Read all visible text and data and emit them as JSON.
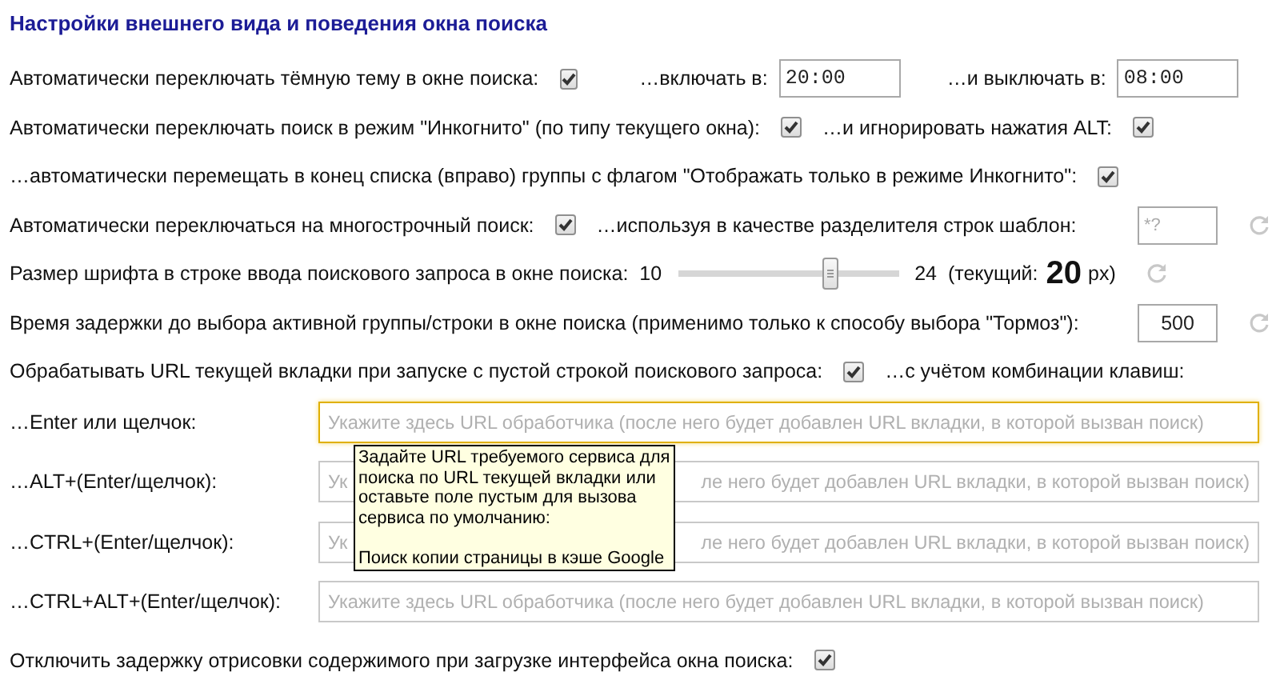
{
  "title": "Настройки внешнего вида и поведения окна поиска",
  "rows": [
    {
      "kind": "inline",
      "items": [
        {
          "kind": "text",
          "text": "Автоматически переключать тёмную тему в окне поиска:"
        },
        {
          "kind": "checkbox",
          "checked": true
        },
        {
          "kind": "text",
          "text": "…включать в:"
        },
        {
          "kind": "time",
          "value": "20:00"
        },
        {
          "kind": "text",
          "text": "…и выключать в:"
        },
        {
          "kind": "time",
          "value": "08:00"
        }
      ]
    },
    {
      "kind": "inline",
      "items": [
        {
          "kind": "text",
          "text": "Автоматически переключать поиск в режим \"Инкогнито\" (по типу текущего окна):"
        },
        {
          "kind": "checkbox",
          "checked": true
        },
        {
          "kind": "text",
          "text": "…и игнорировать нажатия ALT:"
        },
        {
          "kind": "checkbox",
          "checked": true
        }
      ]
    },
    {
      "kind": "inline",
      "items": [
        {
          "kind": "text",
          "text": "…автоматически перемещать в конец списка (вправо) группы с флагом \"Отображать только в режиме Инкогнито\":"
        },
        {
          "kind": "checkbox",
          "checked": true
        }
      ]
    },
    {
      "kind": "inline",
      "items": [
        {
          "kind": "text",
          "text": "Автоматически переключаться на многострочный поиск:"
        },
        {
          "kind": "checkbox",
          "checked": true
        },
        {
          "kind": "text",
          "text": "…используя в качестве разделителя строк шаблон:"
        },
        {
          "kind": "pattern",
          "placeholder": "*?"
        },
        {
          "kind": "reset"
        }
      ]
    },
    {
      "kind": "inline",
      "items": [
        {
          "kind": "text",
          "text": "Размер шрифта в строке ввода поискового запроса в окне поиска:"
        },
        {
          "kind": "text",
          "text": "10"
        },
        {
          "kind": "slider",
          "level": 0.71
        },
        {
          "kind": "text",
          "text": "24"
        },
        {
          "kind": "text",
          "text": "(текущий:"
        },
        {
          "kind": "big",
          "text": "20"
        },
        {
          "kind": "text",
          "text": "px)"
        },
        {
          "kind": "reset"
        }
      ]
    },
    {
      "kind": "inline",
      "items": [
        {
          "kind": "text",
          "text": "Время задержки до выбора активной группы/строки в окне поиска (применимо только к способу выбора \"Тормоз\"):"
        },
        {
          "kind": "number",
          "value": "500"
        },
        {
          "kind": "reset"
        }
      ]
    },
    {
      "kind": "inline",
      "items": [
        {
          "kind": "text",
          "text": "Обрабатывать URL текущей вкладки при запуске с пустой строкой поискового запроса:"
        },
        {
          "kind": "checkbox",
          "checked": true
        },
        {
          "kind": "text",
          "text": "…с учётом комбинации клавиш:"
        }
      ]
    },
    {
      "kind": "url",
      "label": "…Enter или щелчок:",
      "placeholder": "Укажите здесь URL обработчика (после него будет добавлен URL вкладки, в которой вызван поиск)",
      "focused": true
    },
    {
      "kind": "url",
      "label": "…ALT+(Enter/щелчок):",
      "placeholder_start": "Ук",
      "placeholder_end": "ле него будет добавлен URL вкладки, в которой вызван поиск)",
      "focused": false
    },
    {
      "kind": "url",
      "label": "…CTRL+(Enter/щелчок):",
      "placeholder_start": "Ук",
      "placeholder_end": "ле него будет добавлен URL вкладки, в которой вызван поиск)",
      "focused": false
    },
    {
      "kind": "url",
      "label": "…CTRL+ALT+(Enter/щелчок):",
      "placeholder": "Укажите здесь URL обработчика (после него будет добавлен URL вкладки, в которой вызван поиск)",
      "focused": false
    },
    {
      "kind": "inline",
      "items": [
        {
          "kind": "text",
          "text": "Отключить задержку отрисовки содержимого при загрузке интерфейса окна поиска:"
        },
        {
          "kind": "checkbox",
          "checked": true
        }
      ]
    }
  ],
  "tooltip": {
    "lines": [
      "Задайте URL требуемого сервиса для поиска по URL текущей вкладки или оставьте поле пустым для вызова сервиса по умолчанию:",
      "Поиск копии страницы в кэше Google"
    ]
  }
}
